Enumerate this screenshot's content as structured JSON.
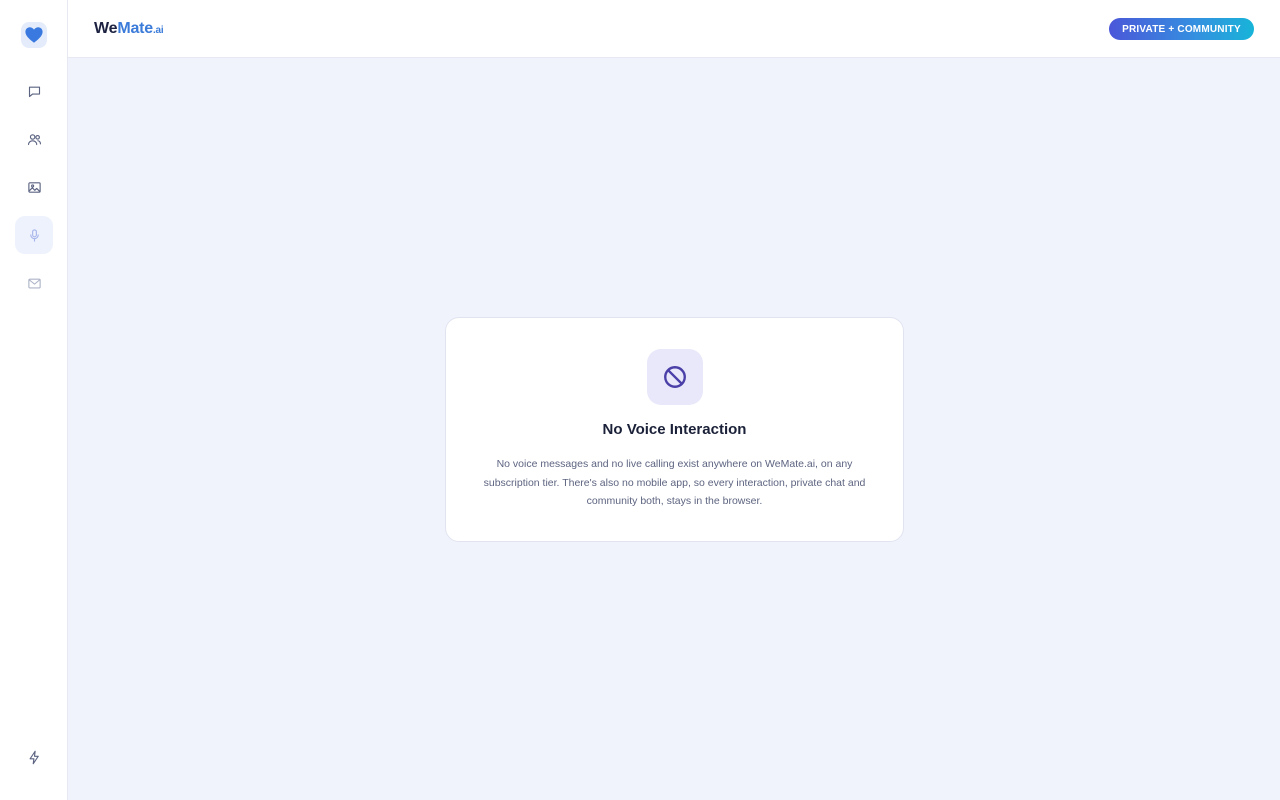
{
  "brand": {
    "we": "We",
    "mate": "Mate",
    "ai": ".ai"
  },
  "header": {
    "badge_label": "PRIVATE + COMMUNITY"
  },
  "sidebar": {
    "items": [
      {
        "icon": "chat-icon",
        "active": false
      },
      {
        "icon": "users-icon",
        "active": false
      },
      {
        "icon": "image-icon",
        "active": false
      },
      {
        "icon": "microphone-icon",
        "active": true
      },
      {
        "icon": "mail-icon",
        "active": false
      }
    ],
    "bottom_icon": "lightning-icon"
  },
  "card": {
    "icon": "prohibited-icon",
    "title": "No Voice Interaction",
    "text": "No voice messages and no live calling exist anywhere on WeMate.ai, on any subscription tier. There's also no mobile app, so every interaction, private chat and community both, stays in the browser."
  },
  "colors": {
    "accent": "#3b7bd9",
    "badge_gradient_start": "#4b57d9",
    "badge_gradient_end": "#18b4d8",
    "background": "#f1f3fc",
    "icon_purple": "#4b3fa8"
  }
}
